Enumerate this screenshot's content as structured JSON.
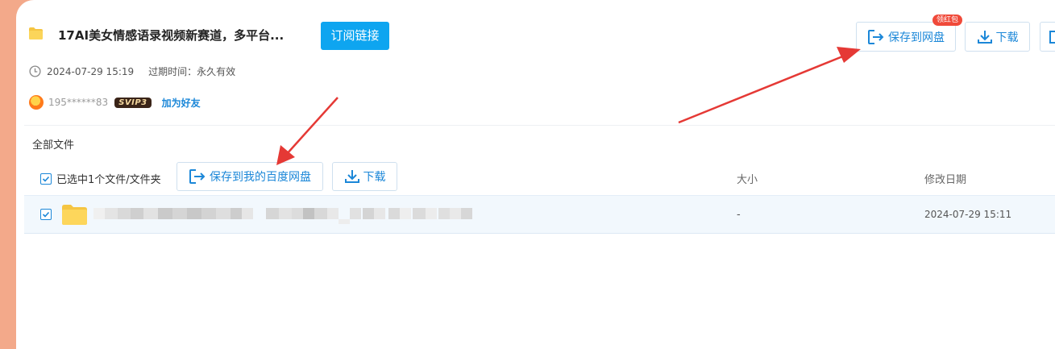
{
  "header": {
    "title": "17AI美女情感语录视频新赛道，多平台...",
    "subscribe_label": "订阅链接",
    "save_label": "保存到网盘",
    "redpacket_badge": "领红包",
    "download_label": "下载"
  },
  "meta": {
    "share_time": "2024-07-29 15:19",
    "expire_label": "过期时间：",
    "expire_value": "永久有效"
  },
  "user": {
    "name": "195******83",
    "vip_badge": "SVIP3",
    "add_friend_label": "加为好友"
  },
  "files": {
    "breadcrumb": "全部文件",
    "selected_label": "已选中1个文件/文件夹",
    "save_label": "保存到我的百度网盘",
    "download_label": "下载",
    "columns": {
      "size": "大小",
      "date": "修改日期"
    },
    "rows": [
      {
        "type": "folder",
        "size": "-",
        "date": "2024-07-29 15:11",
        "checked": true
      }
    ]
  },
  "colors": {
    "accent": "#0ea5f0",
    "link": "#1b87d8",
    "background": "#f3a98a",
    "annotation_arrow": "#e53935"
  }
}
